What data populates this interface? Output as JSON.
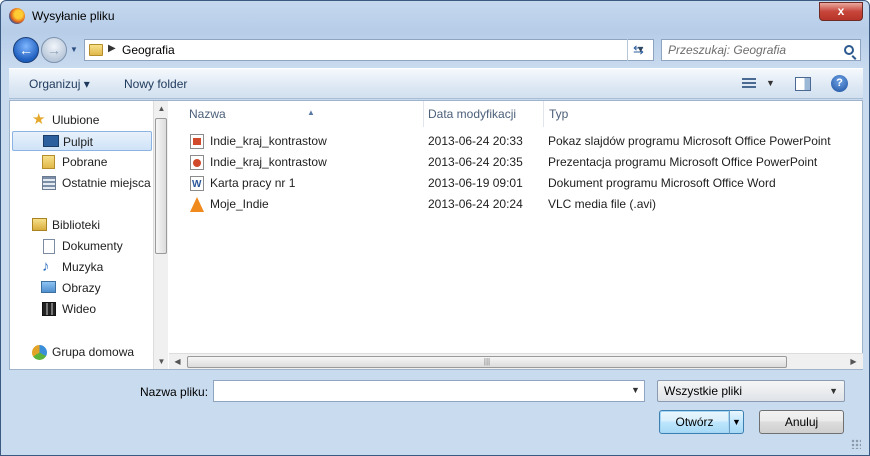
{
  "window": {
    "title": "Wysyłanie pliku",
    "close_label": "x"
  },
  "address": {
    "path": [
      "Geografia"
    ]
  },
  "search": {
    "placeholder": "Przeszukaj: Geografia"
  },
  "toolbar": {
    "organize_label": "Organizuj ▾",
    "new_folder_label": "Nowy folder"
  },
  "sidebar": {
    "favorites_label": "Ulubione",
    "favorites": [
      {
        "label": "Pulpit",
        "icon": "desktop-icon",
        "selected": true
      },
      {
        "label": "Pobrane",
        "icon": "downloads-icon"
      },
      {
        "label": "Ostatnie miejsca",
        "icon": "recent-places-icon"
      }
    ],
    "libraries_label": "Biblioteki",
    "libraries": [
      {
        "label": "Dokumenty",
        "icon": "documents-icon"
      },
      {
        "label": "Muzyka",
        "icon": "music-icon"
      },
      {
        "label": "Obrazy",
        "icon": "pictures-icon"
      },
      {
        "label": "Wideo",
        "icon": "video-icon"
      }
    ],
    "homegroup_label": "Grupa domowa"
  },
  "columns": {
    "name": "Nazwa",
    "modified": "Data modyfikacji",
    "type": "Typ"
  },
  "files": [
    {
      "name": "Indie_kraj_kontrastow",
      "modified": "2013-06-24 20:33",
      "type": "Pokaz slajdów programu Microsoft Office PowerPoint",
      "icon": "powerpoint-show-icon"
    },
    {
      "name": "Indie_kraj_kontrastow",
      "modified": "2013-06-24 20:35",
      "type": "Prezentacja programu Microsoft Office PowerPoint",
      "icon": "powerpoint-icon"
    },
    {
      "name": "Karta pracy nr 1",
      "modified": "2013-06-19 09:01",
      "type": "Dokument programu Microsoft Office Word",
      "icon": "word-icon"
    },
    {
      "name": "Moje_Indie",
      "modified": "2013-06-24 20:24",
      "type": "VLC media file (.avi)",
      "icon": "vlc-icon"
    }
  ],
  "bottom": {
    "filename_label": "Nazwa pliku:",
    "filename_value": "",
    "filter_value": "Wszystkie pliki",
    "open_label": "Otwórz",
    "cancel_label": "Anuluj"
  }
}
